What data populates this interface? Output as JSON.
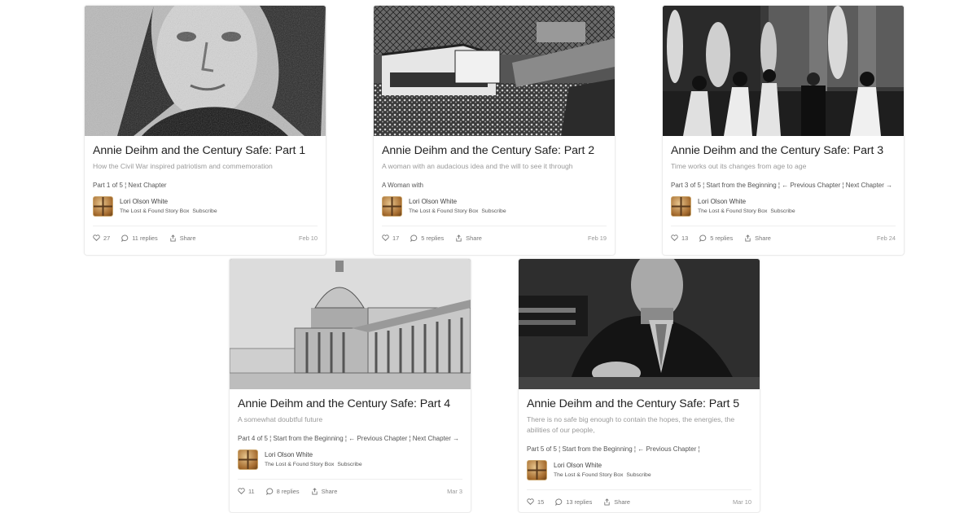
{
  "cards": [
    {
      "title": "Annie Deihm and the Century Safe: Part 1",
      "subtitle": "How the Civil War inspired patriotism and commemoration",
      "nav": "Part 1 of 5 ¦ Next Chapter",
      "author": "Lori Olson White",
      "publication": "The Lost & Found Story Box",
      "subscribe": "Subscribe",
      "likes": "27",
      "replies": "11 replies",
      "share": "Share",
      "date": "Feb 10",
      "image": "portrait of a woman"
    },
    {
      "title": "Annie Deihm and the Century Safe: Part 2",
      "subtitle": "A woman with an audacious idea and the will to see it through",
      "nav": "A Woman with",
      "author": "Lori Olson White",
      "publication": "The Lost & Found Story Box",
      "subscribe": "Subscribe",
      "likes": "17",
      "replies": "5 replies",
      "share": "Share",
      "date": "Feb 19",
      "image": "exposition hall crowd"
    },
    {
      "title": "Annie Deihm and the Century Safe: Part 3",
      "subtitle": "Time works out its changes from age to age",
      "nav": "Part 3 of 5 ¦ Start from the Beginning ¦ ← Previous Chapter ¦ Next Chapter →",
      "author": "Lori Olson White",
      "publication": "The Lost & Found Story Box",
      "subscribe": "Subscribe",
      "likes": "13",
      "replies": "5 replies",
      "share": "Share",
      "date": "Feb 24",
      "image": "statues and visitors"
    },
    {
      "title": "Annie Deihm and the Century Safe: Part 4",
      "subtitle": "A somewhat doubtful future",
      "nav": "Part 4 of 5 ¦ Start from the Beginning ¦ ← Previous Chapter ¦ Next Chapter →",
      "author": "Lori Olson White",
      "publication": "The Lost & Found Story Box",
      "subscribe": "Subscribe",
      "likes": "11",
      "replies": "8 replies",
      "share": "Share",
      "date": "Mar 3",
      "image": "capitol building"
    },
    {
      "title": "Annie Deihm and the Century Safe: Part 5",
      "subtitle": "There is no safe big enough to contain the hopes, the energies, the abilities of our people,",
      "nav": "Part 5 of 5 ¦ Start from the Beginning ¦ ← Previous Chapter ¦",
      "author": "Lori Olson White",
      "publication": "The Lost & Found Story Box",
      "subscribe": "Subscribe",
      "likes": "15",
      "replies": "13 replies",
      "share": "Share",
      "date": "Mar 10",
      "image": "man at desk"
    }
  ],
  "icons": {
    "like": "heart-icon",
    "reply": "comment-icon",
    "share": "share-icon"
  },
  "colors": {
    "title": "#222222",
    "subtitle": "#9a9a9a",
    "meta": "#777777",
    "border": "#ececec"
  }
}
